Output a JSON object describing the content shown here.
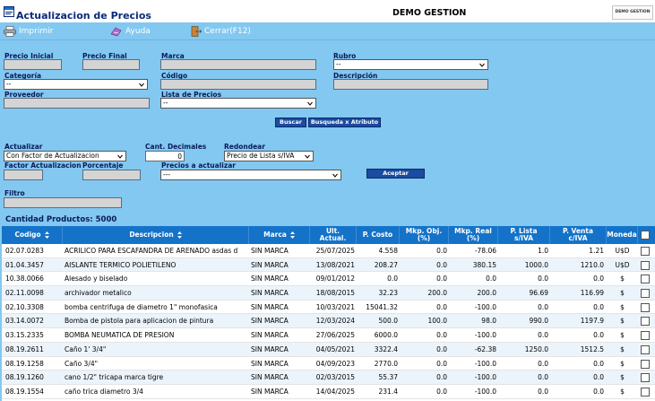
{
  "window": {
    "title": "Actualizacion de Precios",
    "company": "DEMO GESTION",
    "logo_text": "DEMO GESTION"
  },
  "menu": {
    "print": "Imprimir",
    "help": "Ayuda",
    "close": "Cerrar(F12)"
  },
  "filters": {
    "precio_inicial": {
      "label": "Precio Inicial",
      "value": ""
    },
    "precio_final": {
      "label": "Precio Final",
      "value": ""
    },
    "marca": {
      "label": "Marca",
      "value": ""
    },
    "rubro": {
      "label": "Rubro",
      "value": "--"
    },
    "categoria": {
      "label": "Categoría",
      "value": "--"
    },
    "codigo": {
      "label": "Código",
      "value": ""
    },
    "descripcion": {
      "label": "Descripción",
      "value": ""
    },
    "proveedor": {
      "label": "Proveedor",
      "value": ""
    },
    "lista_precios": {
      "label": "Lista de Precios",
      "value": "--"
    },
    "buscar": "Buscar",
    "busqueda_atributo": "Busqueda x Atributo"
  },
  "update": {
    "actualizar": {
      "label": "Actualizar",
      "value": "Con Factor de Actualizacion"
    },
    "cant_decimales": {
      "label": "Cant. Decimales",
      "value": "0"
    },
    "redondear": {
      "label": "Redondear",
      "value": "Precio de Lista s/IVA"
    },
    "factor": {
      "label": "Factor Actualizacion",
      "value": ""
    },
    "porcentaje": {
      "label": "Porcentaje",
      "value": ""
    },
    "precios_actualizar": {
      "label": "Precios a actualizar",
      "value": "---"
    },
    "aceptar": "Aceptar",
    "filtro": {
      "label": "Filtro",
      "value": ""
    }
  },
  "count_text": "Cantidad Productos: 5000",
  "table": {
    "headers": {
      "codigo": "Codigo",
      "descripcion": "Descripcion",
      "marca": "Marca",
      "ult_actual": "Ult. Actual.",
      "p_costo": "P. Costo",
      "mkp_obj": "Mkp. Obj. (%)",
      "mkp_real": "Mkp. Real (%)",
      "p_lista": "P. Lista s/IVA",
      "p_venta": "P. Venta c/IVA",
      "moneda": "Moneda"
    },
    "rows": [
      {
        "codigo": "02.07.0283",
        "descripcion": "ACRILICO PARA ESCAFANDRA DE ARENADO asdas d",
        "marca": "SIN MARCA",
        "fecha": "25/07/2025",
        "costo": "4.558",
        "mkp_obj": "0.0",
        "mkp_real": "-78.06",
        "lista": "1.0",
        "venta": "1.21",
        "moneda": "U$D"
      },
      {
        "codigo": "01.04.3457",
        "descripcion": "AISLANTE TERMICO POLIETILENO",
        "marca": "SIN MARCA",
        "fecha": "13/08/2021",
        "costo": "208.27",
        "mkp_obj": "0.0",
        "mkp_real": "380.15",
        "lista": "1000.0",
        "venta": "1210.0",
        "moneda": "U$D"
      },
      {
        "codigo": "10.38.0066",
        "descripcion": "Alesado y biselado",
        "marca": "SIN MARCA",
        "fecha": "09/01/2012",
        "costo": "0.0",
        "mkp_obj": "0.0",
        "mkp_real": "0.0",
        "lista": "0.0",
        "venta": "0.0",
        "moneda": "$"
      },
      {
        "codigo": "02.11.0098",
        "descripcion": "archivador metalico",
        "marca": "SIN MARCA",
        "fecha": "18/08/2015",
        "costo": "32.23",
        "mkp_obj": "200.0",
        "mkp_real": "200.0",
        "lista": "96.69",
        "venta": "116.99",
        "moneda": "$"
      },
      {
        "codigo": "02.10.3308",
        "descripcion": "bomba centrifuga de diametro 1\" monofasica",
        "marca": "SIN MARCA",
        "fecha": "10/03/2021",
        "costo": "15041.32",
        "mkp_obj": "0.0",
        "mkp_real": "-100.0",
        "lista": "0.0",
        "venta": "0.0",
        "moneda": "$"
      },
      {
        "codigo": "03.14.0072",
        "descripcion": "Bomba de pistola para aplicacion de pintura",
        "marca": "SIN MARCA",
        "fecha": "12/03/2024",
        "costo": "500.0",
        "mkp_obj": "100.0",
        "mkp_real": "98.0",
        "lista": "990.0",
        "venta": "1197.9",
        "moneda": "$"
      },
      {
        "codigo": "03.15.2335",
        "descripcion": "BOMBA NEUMATICA DE PRESION",
        "marca": "SIN MARCA",
        "fecha": "27/06/2025",
        "costo": "6000.0",
        "mkp_obj": "0.0",
        "mkp_real": "-100.0",
        "lista": "0.0",
        "venta": "0.0",
        "moneda": "$"
      },
      {
        "codigo": "08.19.2611",
        "descripcion": "Caño 1' 3/4\"",
        "marca": "SIN MARCA",
        "fecha": "04/05/2021",
        "costo": "3322.4",
        "mkp_obj": "0.0",
        "mkp_real": "-62.38",
        "lista": "1250.0",
        "venta": "1512.5",
        "moneda": "$"
      },
      {
        "codigo": "08.19.1258",
        "descripcion": "Caño 3/4\"",
        "marca": "SIN MARCA",
        "fecha": "04/09/2023",
        "costo": "2770.0",
        "mkp_obj": "0.0",
        "mkp_real": "-100.0",
        "lista": "0.0",
        "venta": "0.0",
        "moneda": "$"
      },
      {
        "codigo": "08.19.1260",
        "descripcion": "cano 1/2\" tricapa marca tigre",
        "marca": "SIN MARCA",
        "fecha": "02/03/2015",
        "costo": "55.37",
        "mkp_obj": "0.0",
        "mkp_real": "-100.0",
        "lista": "0.0",
        "venta": "0.0",
        "moneda": "$"
      },
      {
        "codigo": "08.19.1554",
        "descripcion": "caño trica diametro 3/4",
        "marca": "SIN MARCA",
        "fecha": "14/04/2025",
        "costo": "231.4",
        "mkp_obj": "0.0",
        "mkp_real": "-100.0",
        "lista": "0.0",
        "venta": "0.0",
        "moneda": "$"
      }
    ]
  },
  "icons": {
    "title": "app-window-icon",
    "print": "printer-icon",
    "help": "help-icon",
    "close": "close-door-icon",
    "sort": "sort-icon",
    "dropdown": "chevron-down-icon"
  },
  "colors": {
    "background": "#83c8f0",
    "header": "#1473c8",
    "button": "#1a4ca0",
    "label": "#0a1a5a"
  }
}
